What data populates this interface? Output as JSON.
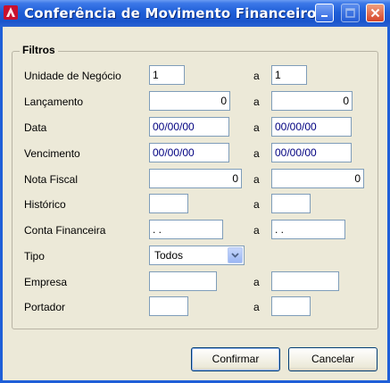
{
  "window": {
    "title": "Conferência de Movimento Financeiro"
  },
  "group": {
    "title": "Filtros"
  },
  "range_separator": "a",
  "rows": {
    "unidade": {
      "label": "Unidade de Negócio",
      "from": "1",
      "to": "1"
    },
    "lancamento": {
      "label": "Lançamento",
      "from": "0",
      "to": "0"
    },
    "data": {
      "label": "Data",
      "from": "00/00/00",
      "to": "00/00/00"
    },
    "vencimento": {
      "label": "Vencimento",
      "from": "00/00/00",
      "to": "00/00/00"
    },
    "nota": {
      "label": "Nota Fiscal",
      "from": "0",
      "to": "0"
    },
    "historico": {
      "label": "Histórico",
      "from": "",
      "to": ""
    },
    "conta": {
      "label": "Conta Financeira",
      "from": " .  .",
      "to": " .  ."
    },
    "tipo": {
      "label": "Tipo",
      "value": "Todos"
    },
    "empresa": {
      "label": "Empresa",
      "from": "",
      "to": ""
    },
    "portador": {
      "label": "Portador",
      "from": "",
      "to": ""
    }
  },
  "buttons": {
    "confirm": "Confirmar",
    "cancel": "Cancelar"
  },
  "colors": {
    "titlebar": "#1f5fd8",
    "dialog_bg": "#ece9d8",
    "field_border": "#7f9db9",
    "date_text": "#000080"
  }
}
